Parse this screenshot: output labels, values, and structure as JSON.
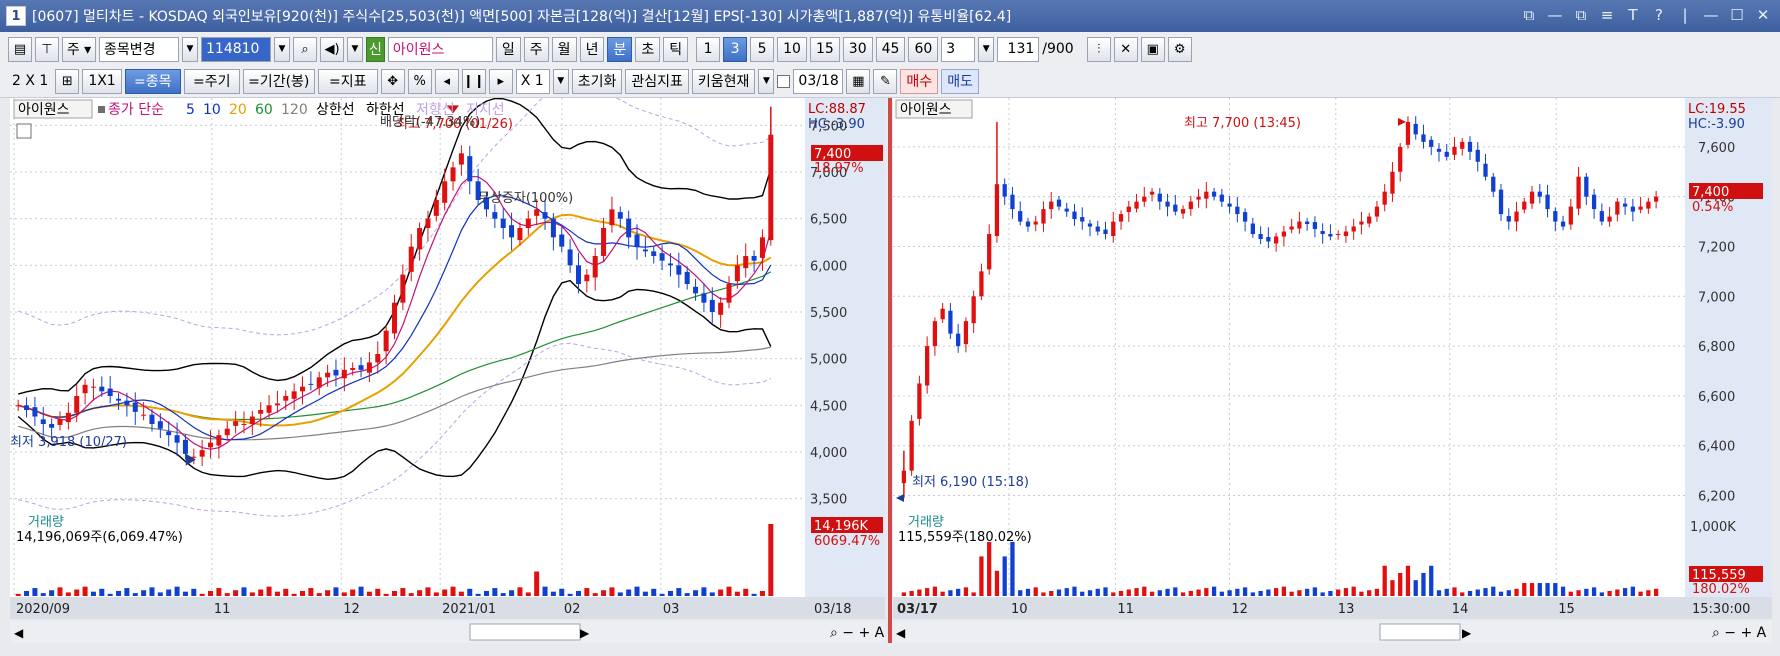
{
  "window": {
    "number": "1",
    "title": "[0607] 멀티차트 - KOSDAQ 외국인보유[920(천)] 주식수[25,503(천)] 액면[500] 자본금[128(억)] 결산[12월] EPS[-130] 시가총액[1,887(억)] 유통비율[62.4]",
    "controls": [
      "⧉",
      "—",
      "⧉",
      "≡",
      "T",
      "?",
      "|",
      "—",
      "☐",
      "✕"
    ]
  },
  "toolbar1": {
    "change_label": "종목변경",
    "code": "114810",
    "stock_prefix": "신",
    "stock_name": "아이원스",
    "periods": [
      "일",
      "주",
      "월",
      "년",
      "분",
      "초",
      "틱"
    ],
    "selected_period": "분",
    "intervals": [
      "1",
      "3",
      "5",
      "10",
      "15",
      "30",
      "45",
      "60"
    ],
    "selected_interval": "3",
    "interval_value": "3",
    "count_value": "131",
    "count_max": "/900"
  },
  "toolbar2": {
    "layout": "2 X 1",
    "layout_1x1": "1X1",
    "btn_stock": "=종목",
    "btn_cycle": "=주기",
    "btn_period": "=기간(봉)",
    "btn_indicator": "=지표",
    "multiplier": "X 1",
    "reset": "초기화",
    "interest": "관심지표",
    "kiwoom": "키움현재",
    "date": "03/18",
    "buy": "매수",
    "sell": "매도"
  },
  "left_chart": {
    "stock": "아이원스",
    "legend": [
      {
        "text": "종가 단순",
        "color": "#c01078"
      },
      {
        "text": "5",
        "color": "#1030c0"
      },
      {
        "text": "10",
        "color": "#1030c0"
      },
      {
        "text": "20",
        "color": "#e8a000"
      },
      {
        "text": "60",
        "color": "#209030"
      },
      {
        "text": "120",
        "color": "#808080"
      },
      {
        "text": "상한선",
        "color": "#000000"
      },
      {
        "text": "하한선",
        "color": "#000000"
      },
      {
        "text": "저항선",
        "color": "#c0a0e8"
      },
      {
        "text": "지지선",
        "color": "#c0a0e8"
      }
    ],
    "lc": "LC:88.87",
    "hc": "HC:-3.90",
    "price_ticks": [
      "7,500",
      "7,000",
      "6,500",
      "6,000",
      "5,500",
      "5,000",
      "4,500",
      "4,000",
      "3,500"
    ],
    "current_price": "7,400",
    "current_change": "18.97%",
    "annot_high": "최고 7,700 (01/26)",
    "annot_dividend": "배당락(-47.34%)",
    "annot_free": "무상증자(100%)",
    "annot_low": "최저 3,918 (10/27)",
    "volume_label": "거래량",
    "volume_value": "14,196,069주(6,069.47%)",
    "volume_badge": "14,196K",
    "volume_pct": "6069.47%",
    "x_labels": [
      "2020/09",
      "11",
      "12",
      "2021/01",
      "02",
      "03",
      "03/18"
    ],
    "chart_data": {
      "type": "candlestick",
      "period": "daily",
      "price_range": [
        3400,
        7750
      ],
      "ma_periods": [
        5,
        10,
        20,
        60,
        120
      ],
      "high": {
        "value": 7700,
        "date": "01/26"
      },
      "low": {
        "value": 3918,
        "date": "10/27"
      },
      "last": {
        "value": 7400,
        "change_pct": 18.97
      },
      "closes": [
        4500,
        4450,
        4380,
        4300,
        4260,
        4350,
        4420,
        4600,
        4720,
        4700,
        4650,
        4600,
        4550,
        4500,
        4430,
        4400,
        4300,
        4250,
        4180,
        4100,
        3980,
        3950,
        4020,
        4100,
        4180,
        4250,
        4330,
        4300,
        4380,
        4450,
        4500,
        4520,
        4600,
        4650,
        4700,
        4720,
        4800,
        4850,
        4820,
        4880,
        4900,
        4880,
        4960,
        5050,
        5300,
        5600,
        5900,
        6200,
        6400,
        6500,
        6700,
        6900,
        7050,
        7200,
        6900,
        6700,
        6600,
        6500,
        6400,
        6300,
        6400,
        6500,
        6600,
        6500,
        6300,
        6200,
        6000,
        5800,
        5900,
        6100,
        6400,
        6600,
        6500,
        6300,
        6200,
        6150,
        6100,
        6050,
        6000,
        5900,
        5800,
        5700,
        5600,
        5500,
        5600,
        5800,
        6000,
        6100,
        6050,
        6300,
        7400
      ],
      "volume_max_label": "14,196K"
    }
  },
  "right_chart": {
    "stock": "아이원스",
    "lc": "LC:19.55",
    "hc": "HC:-3.90",
    "price_ticks": [
      "7,600",
      "7,400",
      "7,200",
      "7,000",
      "6,800",
      "6,600",
      "6,400",
      "6,200"
    ],
    "current_price": "7,400",
    "current_change": "0.54%",
    "annot_high": "최고 7,700 (13:45)",
    "annot_low": "최저 6,190 (15:18)",
    "volume_label": "거래량",
    "volume_value": "115,559주(180.02%)",
    "volume_ticks": [
      "1,000K"
    ],
    "volume_badge": "115,559",
    "volume_pct": "180.02%",
    "x_labels": [
      "03/17",
      "10",
      "11",
      "12",
      "13",
      "14",
      "15",
      "15:30:00"
    ],
    "chart_data": {
      "type": "candlestick",
      "period": "3-minute",
      "price_range": [
        6150,
        7780
      ],
      "high": {
        "value": 7700,
        "time": "13:45"
      },
      "low": {
        "value": 6190,
        "time": "15:18"
      },
      "last": {
        "value": 7400,
        "change_pct": 0.54
      },
      "closes": [
        6300,
        6500,
        6650,
        6800,
        6900,
        6950,
        6850,
        6800,
        6900,
        7000,
        7100,
        7250,
        7450,
        7400,
        7350,
        7300,
        7280,
        7300,
        7350,
        7380,
        7360,
        7340,
        7310,
        7300,
        7280,
        7260,
        7250,
        7300,
        7330,
        7360,
        7380,
        7400,
        7420,
        7380,
        7360,
        7340,
        7350,
        7380,
        7400,
        7420,
        7400,
        7380,
        7360,
        7330,
        7300,
        7250,
        7230,
        7220,
        7240,
        7260,
        7280,
        7300,
        7290,
        7270,
        7250,
        7240,
        7250,
        7260,
        7280,
        7300,
        7320,
        7360,
        7420,
        7500,
        7600,
        7700,
        7650,
        7620,
        7600,
        7580,
        7560,
        7600,
        7620,
        7580,
        7540,
        7480,
        7420,
        7330,
        7300,
        7340,
        7380,
        7420,
        7400,
        7350,
        7300,
        7280,
        7360,
        7480,
        7400,
        7350,
        7300,
        7320,
        7380,
        7360,
        7340,
        7360,
        7380,
        7400
      ],
      "volume_max_label": "1,000K"
    }
  }
}
